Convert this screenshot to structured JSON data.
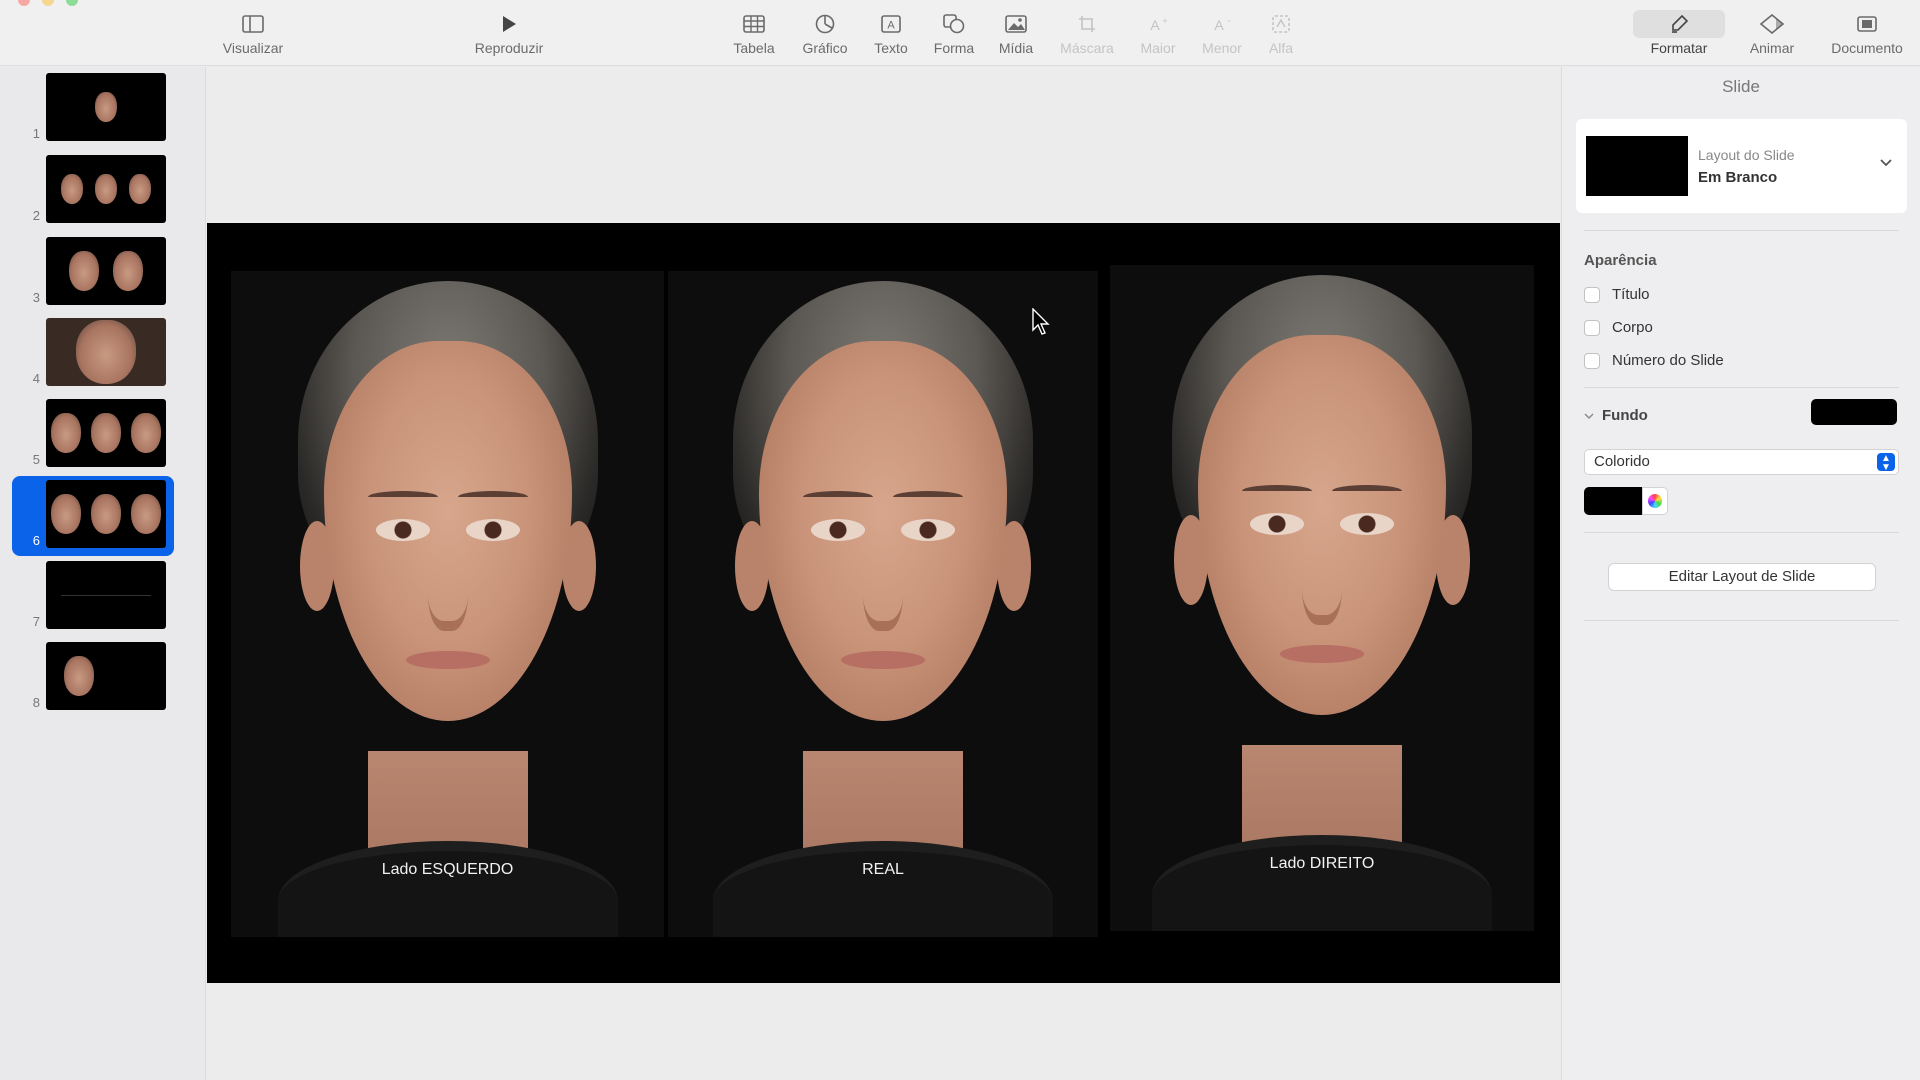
{
  "toolbar": {
    "view": "Visualizar",
    "play": "Reproduzir",
    "table": "Tabela",
    "chart": "Gráfico",
    "text": "Texto",
    "shape": "Forma",
    "media": "Mídia",
    "mask": "Máscara",
    "bigger": "Maior",
    "smaller": "Menor",
    "alpha": "Alfa",
    "format": "Formatar",
    "animate": "Animar",
    "document": "Documento"
  },
  "slides": [
    {
      "number": "1"
    },
    {
      "number": "2"
    },
    {
      "number": "3"
    },
    {
      "number": "4"
    },
    {
      "number": "5"
    },
    {
      "number": "6"
    },
    {
      "number": "7"
    },
    {
      "number": "8"
    }
  ],
  "selected_slide": "6",
  "canvas": {
    "panels": [
      {
        "label": "Lado ESQUERDO"
      },
      {
        "label": "REAL"
      },
      {
        "label": "Lado DIREITO"
      }
    ]
  },
  "inspector": {
    "title": "Slide",
    "layout_caption": "Layout do Slide",
    "layout_name": "Em Branco",
    "appearance_heading": "Aparência",
    "appearance_options": [
      "Título",
      "Corpo",
      "Número do Slide"
    ],
    "background_label": "Fundo",
    "fill_type": "Colorido",
    "background_color": "#000000",
    "edit_layout_button": "Editar Layout de Slide"
  },
  "colors": {
    "accent": "#0a63e8"
  },
  "icons": {
    "view": "sidebar-icon",
    "play": "play-icon",
    "table": "table-icon",
    "chart": "chart-icon",
    "text": "text-box-icon",
    "shape": "shape-icon",
    "media": "image-icon",
    "mask": "crop-icon",
    "bigger": "font-bigger-icon",
    "smaller": "font-smaller-icon",
    "alpha": "alpha-icon",
    "format": "paintbrush-icon",
    "animate": "diamond-icon",
    "document": "document-icon"
  }
}
